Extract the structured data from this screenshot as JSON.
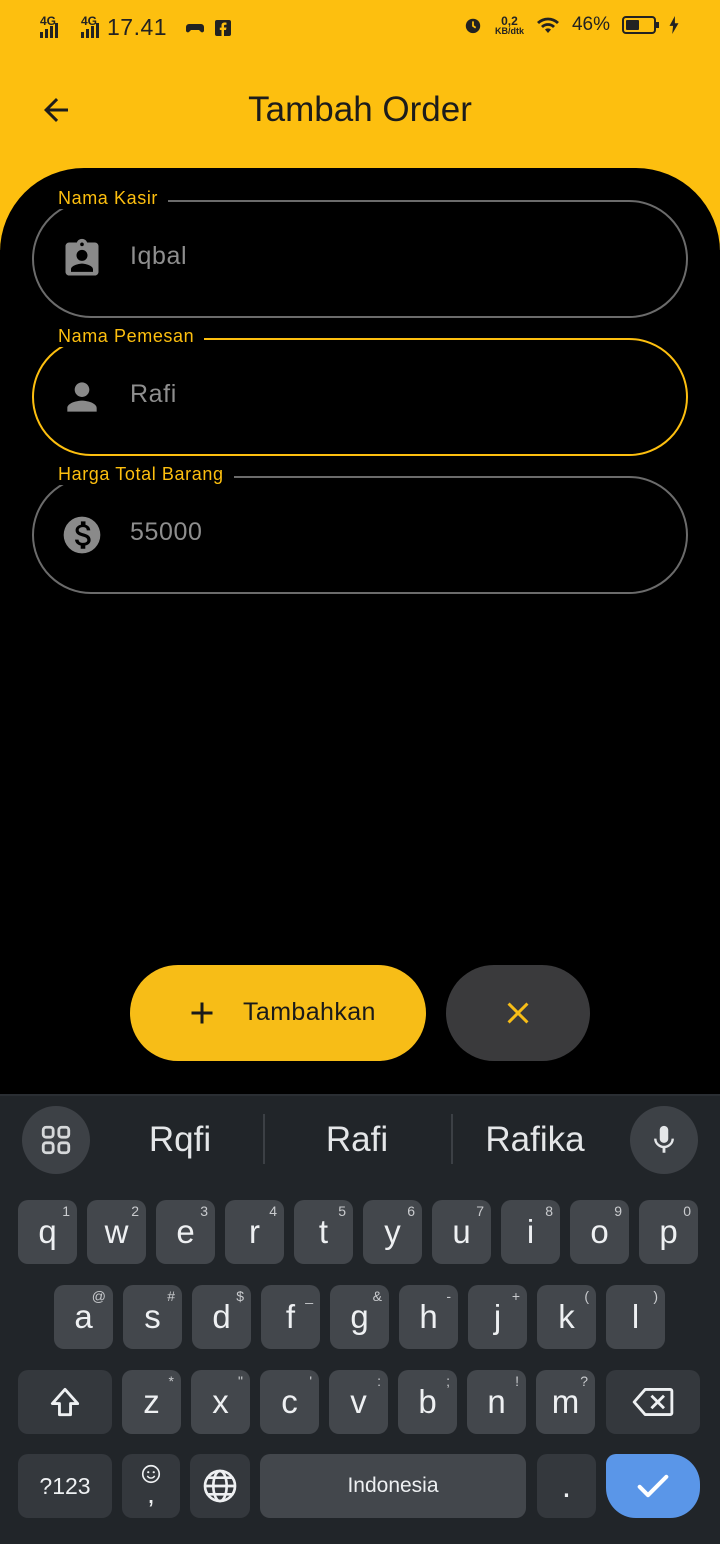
{
  "status_bar": {
    "network_1": "4G",
    "network_2": "4G",
    "time": "17.41",
    "speed_value": "0,2",
    "speed_unit": "KB/dtk",
    "battery": "46%"
  },
  "appbar": {
    "title": "Tambah Order",
    "back_icon": "arrow-left-icon"
  },
  "form": {
    "fields": [
      {
        "label": "Nama Kasir",
        "value": "Iqbal",
        "icon": "badge-icon",
        "focused": false
      },
      {
        "label": "Nama Pemesan",
        "value": "Rafi",
        "icon": "person-icon",
        "focused": true
      },
      {
        "label": "Harga Total Barang",
        "value": "55000",
        "icon": "dollar-icon",
        "focused": false
      }
    ]
  },
  "actions": {
    "add_label": "Tambahkan",
    "add_icon": "plus-icon",
    "cancel_icon": "close-icon"
  },
  "keyboard": {
    "suggestions": [
      "Rqfi",
      "Rafi",
      "Rafika"
    ],
    "row1": [
      {
        "k": "q",
        "h": "1"
      },
      {
        "k": "w",
        "h": "2"
      },
      {
        "k": "e",
        "h": "3"
      },
      {
        "k": "r",
        "h": "4"
      },
      {
        "k": "t",
        "h": "5"
      },
      {
        "k": "y",
        "h": "6"
      },
      {
        "k": "u",
        "h": "7"
      },
      {
        "k": "i",
        "h": "8"
      },
      {
        "k": "o",
        "h": "9"
      },
      {
        "k": "p",
        "h": "0"
      }
    ],
    "row2": [
      {
        "k": "a",
        "h": "@"
      },
      {
        "k": "s",
        "h": "#"
      },
      {
        "k": "d",
        "h": "$"
      },
      {
        "k": "f",
        "h": "_"
      },
      {
        "k": "g",
        "h": "&"
      },
      {
        "k": "h",
        "h": "-"
      },
      {
        "k": "j",
        "h": "+"
      },
      {
        "k": "k",
        "h": "("
      },
      {
        "k": "l",
        "h": ")"
      }
    ],
    "row3": [
      {
        "k": "z",
        "h": "*"
      },
      {
        "k": "x",
        "h": "\""
      },
      {
        "k": "c",
        "h": "'"
      },
      {
        "k": "v",
        "h": ":"
      },
      {
        "k": "b",
        "h": ";"
      },
      {
        "k": "n",
        "h": "!"
      },
      {
        "k": "m",
        "h": "?"
      }
    ],
    "symbols_label": "?123",
    "comma_label": ",",
    "space_label": "Indonesia",
    "period_label": ".",
    "accent_color": "#5a96e8"
  },
  "colors": {
    "primary": "#FDBF0F",
    "background": "#000000",
    "field_border": "#6b6b6b"
  }
}
